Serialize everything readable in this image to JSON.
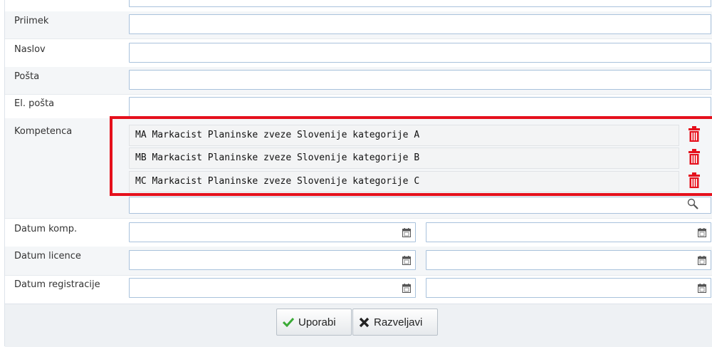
{
  "fields": {
    "priimek": "Priimek",
    "naslov": "Naslov",
    "posta": "Pošta",
    "el_posta": "El. pošta",
    "kompetenca": "Kompetenca",
    "datum_komp": "Datum komp.",
    "datum_licence": "Datum licence",
    "datum_registracije": "Datum registracije"
  },
  "kompetence": [
    "MA Markacist Planinske zveze Slovenije kategorije A",
    "MB Markacist Planinske zveze Slovenije kategorije B",
    "MC Markacist Planinske zveze Slovenije kategorije C"
  ],
  "buttons": {
    "apply": "Uporabi",
    "cancel": "Razveljavi"
  },
  "colors": {
    "highlight": "#e5101c",
    "trash": "#e5101c",
    "apply_check": "#3aaa35"
  }
}
